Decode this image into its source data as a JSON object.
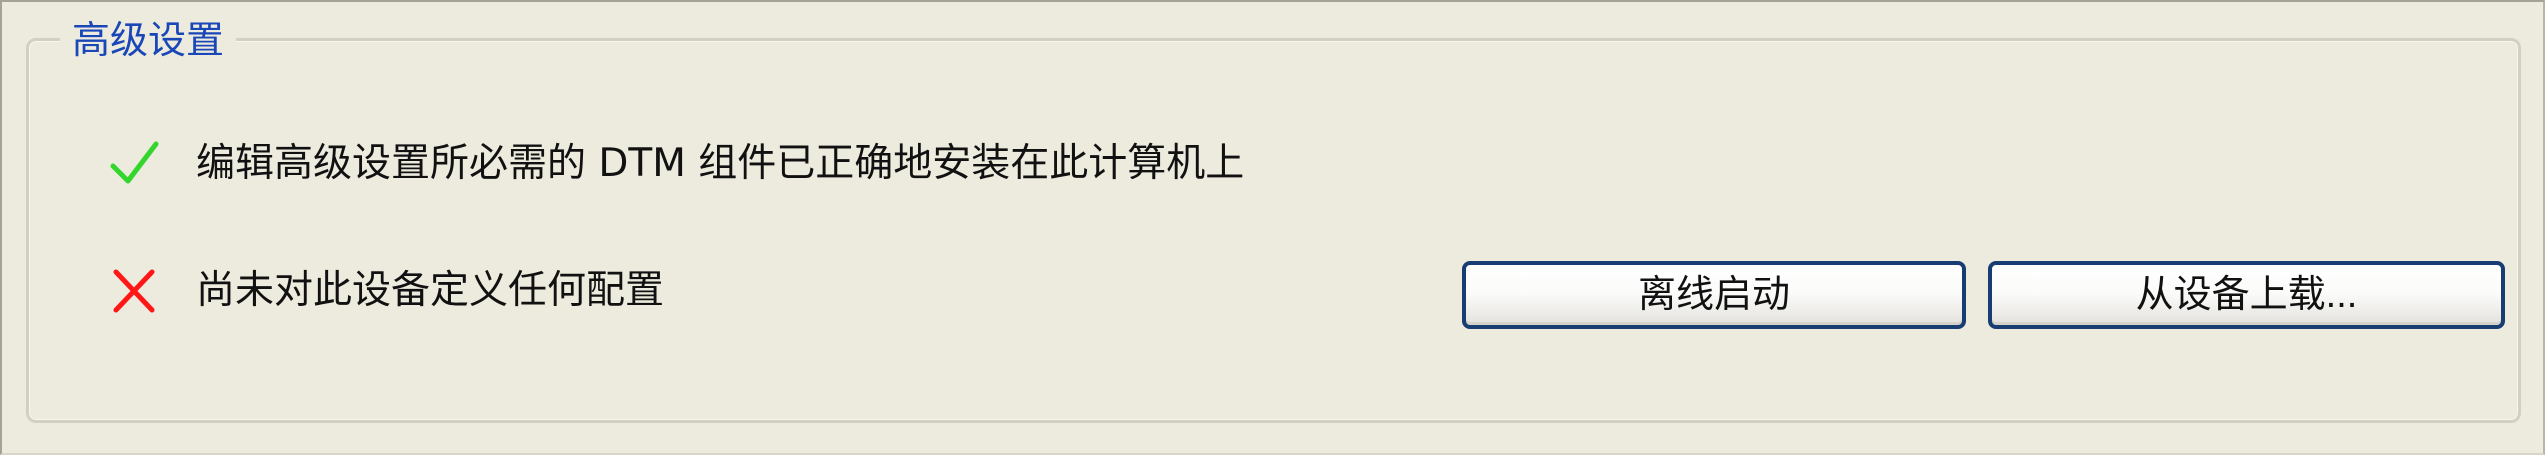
{
  "group": {
    "title": "高级设置"
  },
  "statuses": [
    {
      "icon": "check-icon",
      "text": "编辑高级设置所必需的 DTM 组件已正确地安装在此计算机上",
      "color": "#32d62d"
    },
    {
      "icon": "cross-icon",
      "text": "尚未对此设备定义任何配置",
      "color": "#ff1717"
    }
  ],
  "buttons": {
    "offline_start": "离线启动",
    "upload_from_device": "从设备上载..."
  },
  "colors": {
    "legend": "#1a47b8",
    "button_border": "#173d72",
    "panel": "#edeade"
  }
}
